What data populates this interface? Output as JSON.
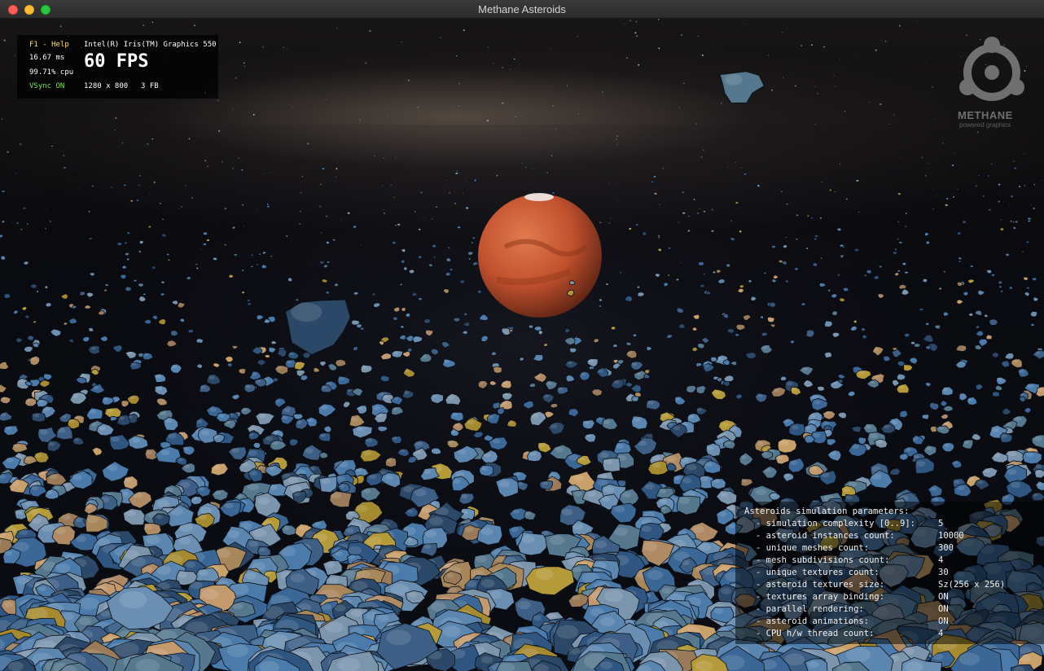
{
  "window": {
    "title": "Methane Asteroids"
  },
  "hud": {
    "help": "F1 - Help",
    "gpu": "Intel(R) Iris(TM) Graphics 550",
    "frame_time": "16.67 ms",
    "fps": "60 FPS",
    "cpu": "99.71% cpu",
    "vsync": "VSync ON",
    "resolution": "1280 x 800",
    "frame_buffers": "3 FB"
  },
  "logo": {
    "name": "METHANE",
    "tagline": "powered graphics"
  },
  "params": {
    "title": "Asteroids simulation parameters:",
    "rows": [
      {
        "label": "- simulation complexity [0..9]:",
        "value": "5"
      },
      {
        "label": "- asteroid instances count:",
        "value": "10000"
      },
      {
        "label": "- unique meshes count:",
        "value": "300"
      },
      {
        "label": "- mesh subdivisions count:",
        "value": "4"
      },
      {
        "label": "- unique textures count:",
        "value": "30"
      },
      {
        "label": "- asteroid textures size:",
        "value": "Sz(256 x 256)"
      },
      {
        "label": "- textures array binding:",
        "value": "ON"
      },
      {
        "label": "- parallel rendering:",
        "value": "ON"
      },
      {
        "label": "- asteroid animations:",
        "value": "ON"
      },
      {
        "label": "- CPU h/w thread count:",
        "value": "4"
      }
    ]
  },
  "colors": {
    "help_text": "#ffe24a",
    "vsync_text": "#74e24a",
    "planet": "#c2512e",
    "asteroid_blue": "#3f6c9c",
    "asteroid_tan": "#b08a64"
  }
}
